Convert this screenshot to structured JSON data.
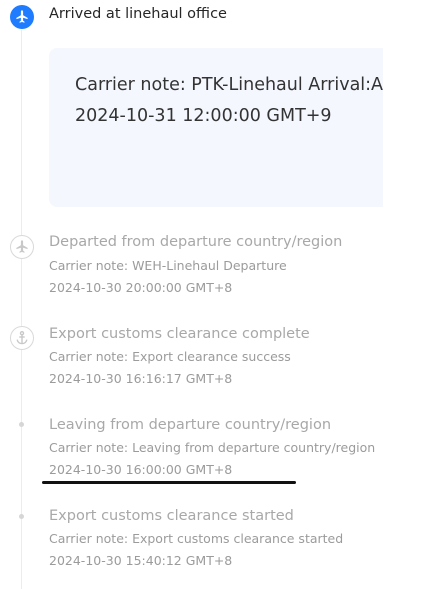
{
  "colors": {
    "accent": "#1f7cff",
    "card_background": "#f5f7ff",
    "muted_text": "#9b9b9b",
    "timeline_line": "#ececec"
  },
  "events": [
    {
      "status": "Arrived at linehaul office",
      "note": "Carrier note: PTK-Linehaul Arrival:Arrived at linehaul office",
      "time": "2024-10-31 12:00:00 GMT+9",
      "icon": "airplane-icon",
      "current": true
    },
    {
      "status": "Departed from departure country/region",
      "note": "Carrier note: WEH-Linehaul Departure",
      "time": "2024-10-30 20:00:00 GMT+8",
      "icon": "airplane-icon"
    },
    {
      "status": "Export customs clearance complete",
      "note": "Carrier note: Export clearance success",
      "time": "2024-10-30 16:16:17 GMT+8",
      "icon": "anchor-icon"
    },
    {
      "status": "Leaving from departure country/region",
      "note": "Carrier note: Leaving from departure country/region",
      "time": "2024-10-30 16:00:00 GMT+8",
      "icon": "dot"
    },
    {
      "status": "Export customs clearance started",
      "note": "Carrier note: Export customs clearance started",
      "time": "2024-10-30 15:40:12 GMT+8",
      "icon": "dot"
    }
  ]
}
